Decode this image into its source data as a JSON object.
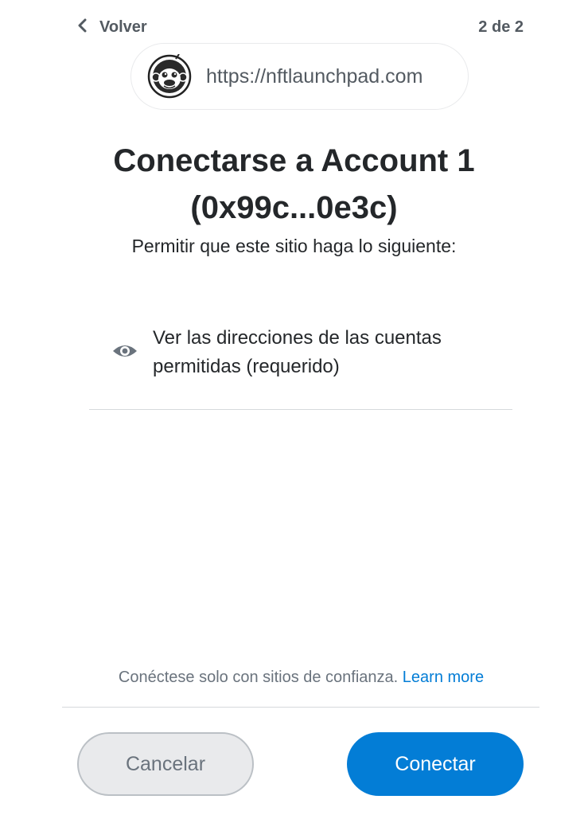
{
  "header": {
    "back_label": "Volver",
    "step": "2 de 2"
  },
  "site": {
    "url": "https://nftlaunchpad.com",
    "icon": "monkey-astronaut-logo"
  },
  "title": {
    "line1": "Conectarse a Account 1",
    "line2": "(0x99c...0e3c)"
  },
  "subtitle": "Permitir que este sitio haga lo siguiente:",
  "permissions": [
    {
      "icon": "eye-icon",
      "line1": "Ver las direcciones de las cuentas",
      "line2": "permitidas (requerido)"
    }
  ],
  "footer": {
    "trust_text": "Conéctese solo con sitios de confianza.",
    "learn_more": "Learn more"
  },
  "buttons": {
    "cancel": "Cancelar",
    "connect": "Conectar"
  },
  "colors": {
    "primary": "#037dd6",
    "text": "#24272a",
    "muted": "#6a737d",
    "border": "#d6d9dc"
  }
}
